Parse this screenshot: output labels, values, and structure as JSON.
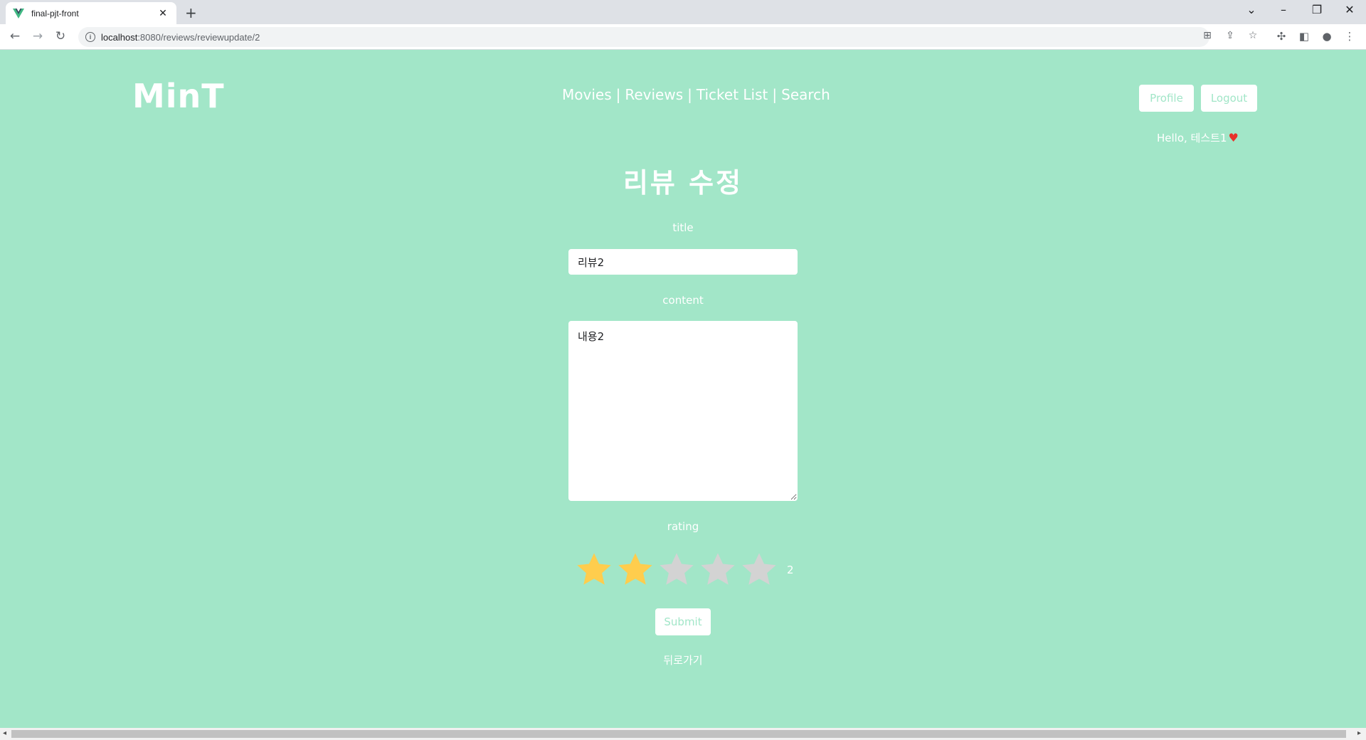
{
  "browser": {
    "tab_title": "final-pjt-front",
    "tab_close": "✕",
    "new_tab": "+",
    "url_host": "localhost",
    "url_path": ":8080/reviews/reviewupdate/2",
    "info_glyph": "i"
  },
  "header": {
    "logo": "MinT",
    "nav": [
      "Movies",
      "Reviews",
      "Ticket List",
      "Search"
    ],
    "nav_separator": "|",
    "profile_button": "Profile",
    "logout_button": "Logout",
    "greeting": "Hello, 테스트1",
    "heart_glyph": "♥"
  },
  "form": {
    "page_title": "리뷰 수정",
    "title_label": "title",
    "title_value": "리뷰2",
    "content_label": "content",
    "content_value": "내용2",
    "rating_label": "rating",
    "rating_value": "2",
    "rating": 2,
    "rating_max": 5,
    "submit_button": "Submit",
    "back_link": "뒤로가기"
  },
  "colors": {
    "background": "#a2e6c8",
    "star_filled": "#ffcd4d",
    "star_empty": "#d3d3d3",
    "heart": "#e8322b"
  }
}
